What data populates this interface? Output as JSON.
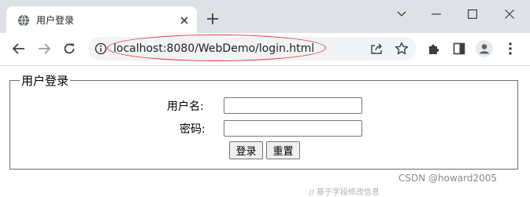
{
  "browser": {
    "tab": {
      "title": "用户登录",
      "favicon": "globe-icon",
      "close_icon": "close-icon"
    },
    "new_tab_icon": "plus-icon",
    "window_controls": [
      "chevron-down-icon",
      "minimize-icon",
      "maximize-icon",
      "close-icon"
    ],
    "toolbar": {
      "back_icon": "back-arrow-icon",
      "forward_icon": "forward-arrow-icon",
      "reload_icon": "reload-icon",
      "url": "localhost:8080/WebDemo/login.html",
      "site_info_icon": "info-icon",
      "share_icon": "share-icon",
      "bookmark_icon": "star-icon",
      "extensions_icon": "puzzle-icon",
      "side_panel_icon": "side-panel-icon",
      "profile_icon": "avatar-icon",
      "menu_icon": "kebab-menu-icon"
    },
    "annotation_color": "#e0363c"
  },
  "form": {
    "legend": "用户登录",
    "username_label": "用户名:",
    "username_value": "",
    "password_label": "密码:",
    "password_value": "",
    "login_button": "登录",
    "reset_button": "重置"
  },
  "overlay": {
    "watermark": "CSDN @howard2005",
    "background_fragment": "// 基于字段修改信息"
  }
}
